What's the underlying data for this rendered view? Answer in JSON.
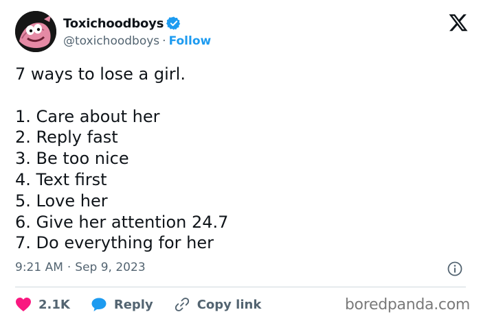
{
  "author": {
    "display_name": "Toxichoodboys",
    "handle": "@toxichoodboys",
    "separator": "·",
    "follow_label": "Follow",
    "verified": true
  },
  "tweet": {
    "lines": [
      "7 ways to lose a girl.",
      "",
      "1. Care about her",
      "2. Reply fast",
      "3. Be too nice",
      "4. Text first",
      "5. Love her",
      "6. Give her attention 24.7",
      "7. Do everything for her"
    ]
  },
  "meta": {
    "time": "9:21 AM",
    "separator": "·",
    "date": "Sep 9, 2023"
  },
  "actions": {
    "likes": "2.1K",
    "reply_label": "Reply",
    "copy_link_label": "Copy link"
  },
  "watermark": "boredpanda.com",
  "colors": {
    "accent": "#1d9bf0",
    "like": "#f91880",
    "text": "#0f1419",
    "muted": "#536471",
    "divider": "#cfd9de"
  },
  "icons": {
    "verified": "verified-badge-icon",
    "logo": "x-logo-icon",
    "info": "info-icon",
    "like": "heart-icon",
    "reply": "speech-bubble-icon",
    "copy_link": "link-icon"
  }
}
